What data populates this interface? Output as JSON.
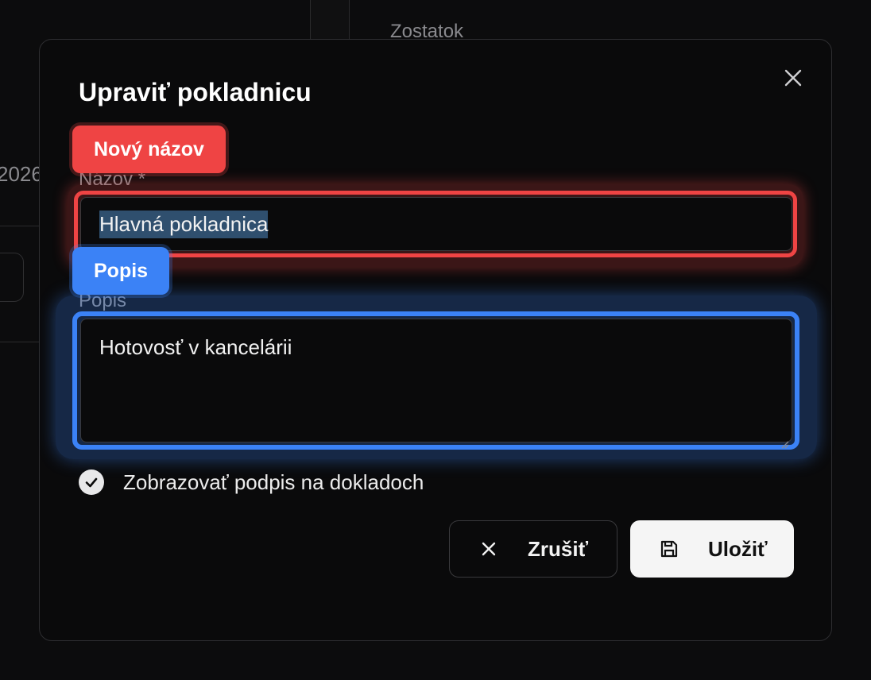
{
  "background": {
    "column_header": "Zostatok",
    "year_fragment": "2026"
  },
  "modal": {
    "title": "Upraviť pokladnicu",
    "close_icon": "close-icon",
    "annotations": {
      "name_tag": "Nový názov",
      "description_tag": "Popis"
    },
    "fields": {
      "name_label": "Názov *",
      "name_value": "Hlavná pokladnica",
      "description_label": "Popis",
      "description_value": "Hotovosť v kancelárii"
    },
    "checkbox": {
      "label": "Zobrazovať podpis na dokladoch",
      "checked": true,
      "icon": "check-circle-icon"
    },
    "buttons": {
      "cancel_label": "Zrušiť",
      "cancel_icon": "x-icon",
      "save_label": "Uložiť",
      "save_icon": "floppy-disk-icon"
    }
  },
  "colors": {
    "highlight_red": "#ef4444",
    "highlight_blue": "#3b82f6"
  }
}
